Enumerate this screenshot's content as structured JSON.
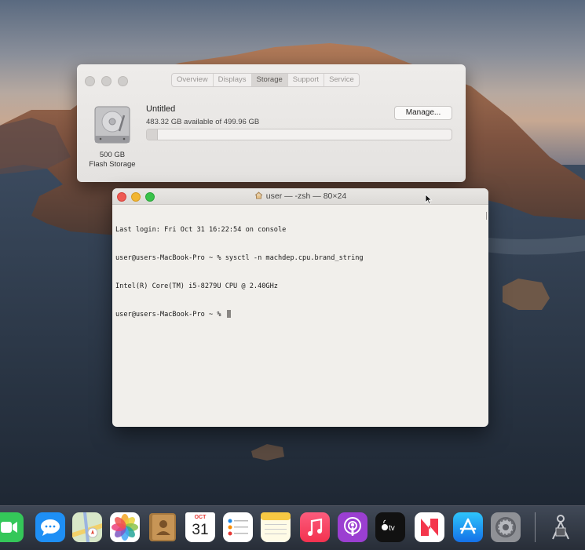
{
  "about_window": {
    "tabs": [
      {
        "label": "Overview",
        "selected": false
      },
      {
        "label": "Displays",
        "selected": false
      },
      {
        "label": "Storage",
        "selected": true
      },
      {
        "label": "Support",
        "selected": false
      },
      {
        "label": "Service",
        "selected": false
      }
    ],
    "volume_name": "Untitled",
    "availability": "483.32 GB available of 499.96 GB",
    "manage_label": "Manage...",
    "drive_size": "500 GB",
    "drive_type": "Flash Storage",
    "used_fraction": 0.033
  },
  "terminal": {
    "title": "user — -zsh — 80×24",
    "lines": [
      "Last login: Fri Oct 31 16:22:54 on console",
      "user@users-MacBook-Pro ~ % sysctl -n machdep.cpu.brand_string",
      "Intel(R) Core(TM) i5-8279U CPU @ 2.40GHz",
      "user@users-MacBook-Pro ~ % "
    ]
  },
  "dock": {
    "calendar_month": "OCT",
    "calendar_day": "31",
    "items": [
      {
        "name": "facetime-icon"
      },
      {
        "name": "messages-icon"
      },
      {
        "name": "maps-icon"
      },
      {
        "name": "photos-icon"
      },
      {
        "name": "contacts-icon"
      },
      {
        "name": "calendar-icon"
      },
      {
        "name": "reminders-icon"
      },
      {
        "name": "notes-icon"
      },
      {
        "name": "music-icon"
      },
      {
        "name": "podcasts-icon"
      },
      {
        "name": "apple-tv-icon"
      },
      {
        "name": "news-icon"
      },
      {
        "name": "app-store-icon"
      },
      {
        "name": "system-preferences-icon"
      },
      {
        "name": "downloads-icon"
      }
    ]
  },
  "colors": {
    "close": "#ee5a52",
    "minimize": "#f2b631",
    "zoom": "#39c24a"
  }
}
